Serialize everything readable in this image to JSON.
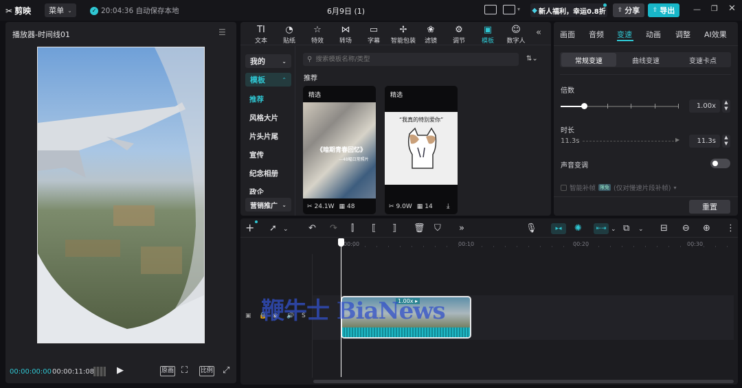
{
  "app": {
    "logo": "剪映",
    "menu": "菜单",
    "autosave": "20:04:36 自动保存本地",
    "project_title": "6月9日 (1)",
    "promo": "新人福利，幸运0.8折",
    "share": "分享",
    "export": "导出"
  },
  "player": {
    "title": "播放器-时间线01",
    "time_current": "00:00:00:00",
    "time_total": "00:00:11:08",
    "btn_original": "原画",
    "btn_ratio": "比例"
  },
  "toolbar": {
    "items": [
      "文本",
      "贴纸",
      "特效",
      "转场",
      "字幕",
      "智能包装",
      "滤镜",
      "调节",
      "模板",
      "数字人"
    ],
    "active": "模板"
  },
  "template": {
    "dropdown_mine": "我的",
    "dropdown_template": "模板",
    "categories": [
      "推荐",
      "风格大片",
      "片头片尾",
      "宣传",
      "纪念相册",
      "政企"
    ],
    "dropdown_marketing": "营销推广",
    "search_placeholder": "搜索模板名称/类型",
    "section_title": "推荐",
    "cards": [
      {
        "badge": "精选",
        "title": "《暗期青春回忆》",
        "subtitle": "—48幅日常照片",
        "uses": "24.1W",
        "clips": "48"
      },
      {
        "badge": "精选",
        "caption": "“我真的特别爱你”",
        "uses": "9.0W",
        "clips": "14"
      }
    ]
  },
  "inspector": {
    "tabs": [
      "画面",
      "音频",
      "变速",
      "动画",
      "调整",
      "AI效果"
    ],
    "active_tab": "变速",
    "segments": [
      "常规变速",
      "曲线变速",
      "变速卡点"
    ],
    "speed_label": "倍数",
    "speed_value": "1.00x",
    "duration_label": "时长",
    "duration_start": "11.3s",
    "duration_value": "11.3s",
    "pitch_label": "声音变调",
    "smart_fill": "智能补帧",
    "smart_fill_badge": "限免",
    "smart_fill_note": "(仅对慢速片段补帧)",
    "reset": "重置"
  },
  "timeline": {
    "ruler": [
      "00:00",
      "00:10",
      "00:20",
      "00:30"
    ],
    "cover": "封面",
    "clip_speed": "1.00x",
    "watermark": "鞭牛士 BiaNews"
  },
  "colors": {
    "accent": "#2fc7d3",
    "bg": "#101014",
    "panel": "#202024",
    "export_btn": "#18b7c9"
  }
}
